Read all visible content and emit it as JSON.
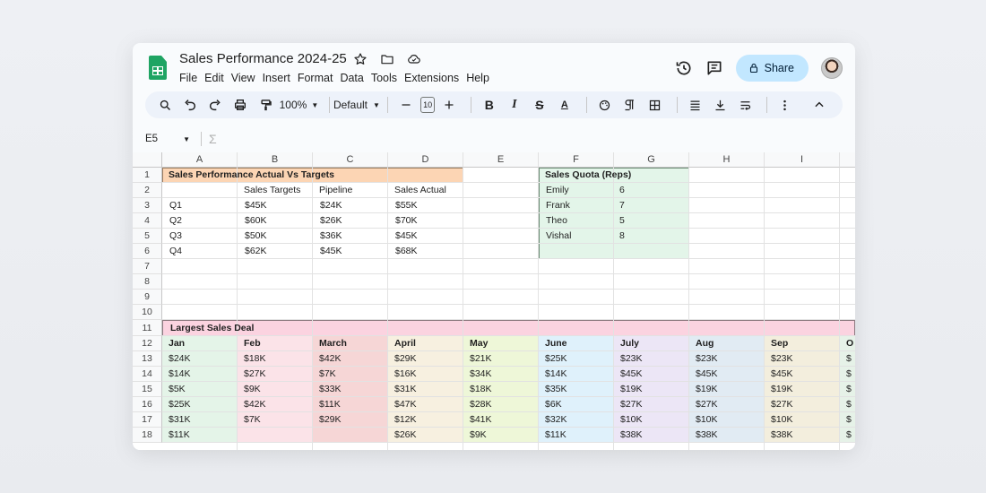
{
  "doc": {
    "title": "Sales Performance 2024-25",
    "title_icons": [
      "star-icon",
      "folder-icon",
      "cloud-icon"
    ]
  },
  "menu": [
    "File",
    "Edit",
    "View",
    "Insert",
    "Format",
    "Data",
    "Tools",
    "Extensions",
    "Help"
  ],
  "header": {
    "share_label": "Share"
  },
  "toolbar": {
    "zoom": "100%",
    "font": "Default",
    "font_size": "10"
  },
  "formula_bar": {
    "cell_ref": "E5",
    "formula": ""
  },
  "columns": [
    "A",
    "B",
    "C",
    "D",
    "E",
    "F",
    "G",
    "H",
    "I"
  ],
  "rows": [
    "1",
    "2",
    "3",
    "4",
    "5",
    "6",
    "7",
    "8",
    "9",
    "10",
    "11",
    "12",
    "13",
    "14",
    "15",
    "16",
    "17",
    "18"
  ],
  "table1": {
    "title": "Sales Performance Actual Vs Targets",
    "headers": [
      "",
      "Sales Targets",
      "Pipeline",
      "Sales Actual"
    ],
    "rows": [
      [
        "Q1",
        "$45K",
        "$24K",
        "$55K"
      ],
      [
        "Q2",
        "$60K",
        "$26K",
        "$70K"
      ],
      [
        "Q3",
        "$50K",
        "$36K",
        "$45K"
      ],
      [
        "Q4",
        "$62K",
        "$45K",
        "$68K"
      ]
    ]
  },
  "quota": {
    "title": "Sales Quota (Reps)",
    "rows": [
      [
        "Emily",
        "6"
      ],
      [
        "Frank",
        "7"
      ],
      [
        "Theo",
        "5"
      ],
      [
        "Vishal",
        "8"
      ]
    ]
  },
  "deals": {
    "title": "Largest Sales Deal",
    "months": [
      "Jan",
      "Feb",
      "March",
      "April",
      "May",
      "June",
      "July",
      "Aug",
      "Sep",
      "O"
    ],
    "values": [
      [
        "$24K",
        "$18K",
        "$42K",
        "$29K",
        "$21K",
        "$25K",
        "$23K",
        "$23K",
        "$23K",
        "$"
      ],
      [
        "$14K",
        "$27K",
        "$7K",
        "$16K",
        "$34K",
        "$14K",
        "$45K",
        "$45K",
        "$45K",
        "$"
      ],
      [
        "$5K",
        "$9K",
        "$33K",
        "$31K",
        "$18K",
        "$35K",
        "$19K",
        "$19K",
        "$19K",
        "$"
      ],
      [
        "$25K",
        "$42K",
        "$11K",
        "$47K",
        "$28K",
        "$6K",
        "$27K",
        "$27K",
        "$27K",
        "$"
      ],
      [
        "$31K",
        "$7K",
        "$29K",
        "$12K",
        "$41K",
        "$32K",
        "$10K",
        "$10K",
        "$10K",
        "$"
      ],
      [
        "$11K",
        "",
        "",
        "$26K",
        "$9K",
        "$11K",
        "$38K",
        "$38K",
        "$38K",
        "$"
      ]
    ],
    "colors": [
      "#e4f4e8",
      "#fbe3e8",
      "#f6d6d6",
      "#f7f0e0",
      "#eef7d8",
      "#dff1fb",
      "#ece6f6",
      "#e1ebf3",
      "#f3eedd",
      "#e6f2e8"
    ]
  },
  "colors": {
    "table1_title_bg": "#fcd5b4",
    "quota_bg": "#e3f5e9",
    "deals_title_bg": "#fbd3e0",
    "share_bg": "#c2e7ff"
  }
}
